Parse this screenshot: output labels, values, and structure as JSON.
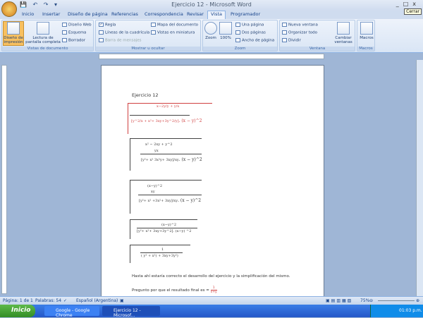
{
  "window": {
    "title": "Ejercicio 12 - Microsoft Word",
    "tooltip": "Cerrar",
    "controls": [
      "_",
      "□",
      "x"
    ]
  },
  "qat": [
    "save-icon",
    "undo-icon",
    "redo-icon",
    "customize-icon"
  ],
  "tabs": [
    "Inicio",
    "Insertar",
    "Diseño de página",
    "Referencias",
    "Correspondencia",
    "Revisar",
    "Vista",
    "Programador"
  ],
  "active_tab": "Vista",
  "ribbon": {
    "vistas": {
      "label": "Vistas de documento",
      "print": "Diseño de impresión",
      "reading": "Lectura de pantalla completa",
      "web": "Diseño Web",
      "outline": "Esquema",
      "draft": "Borrador"
    },
    "mostrar": {
      "label": "Mostrar u ocultar",
      "ruler": "Regla",
      "grid": "Líneas de la cuadrícula",
      "msgbar": "Barra de mensajes",
      "docmap": "Mapa del documento",
      "thumbs": "Vistas en miniatura",
      "ruler_checked": true
    },
    "zoom": {
      "label": "Zoom",
      "zoom": "Zoom",
      "pct": "100%",
      "one": "Una página",
      "two": "Dos páginas",
      "width": "Ancho de página"
    },
    "ventana": {
      "label": "Ventana",
      "new": "Nueva ventana",
      "arrange": "Organizar todo",
      "split": "Dividir",
      "switch": "Cambiar ventanas"
    },
    "macros": {
      "label": "Macros",
      "macros": "Macros"
    }
  },
  "document": {
    "heading": "Ejercicio 12",
    "eq1": {
      "num_a": "x−2y",
      "den_a": "y",
      "num_b": "y",
      "den_b": "x",
      "d1n": "y^2",
      "d1d": "x",
      "d2n": "x²+ 3xy+3y^2",
      "d2d": "y",
      "tail": ". (x − y)^2"
    },
    "eq2": {
      "num": "x² − 2xy + y^2",
      "numd": "yx",
      "dn": "y²+ x² 3x²y+ 3xy",
      "dd": "xy",
      "tail": ". (x − y)^2"
    },
    "eq3": {
      "num": "(x−y)^2",
      "numd": "xy",
      "dn": "y²+ x² +3x²+ 3xy",
      "dd": "xy",
      "tail": ". (x − y)^2"
    },
    "eq4": {
      "num": "(x−y)^2",
      "den": "[y²+ x²+ 3xy+3y^2]. (x−y) ^2"
    },
    "eq5": {
      "num": "1",
      "den": "( y² + x²) + 3xy+3y²)"
    },
    "para1": "Hasta ahí estaría correcto el desarrollo del ejercicio y la simplificación del mismo.",
    "para2": "Pregunto por que el resultado final es =",
    "result_num": "1",
    "result_den": "x+y"
  },
  "status": {
    "page": "Página: 1 de 1",
    "words": "Palabras: 54",
    "lang": "Español (Argentina)",
    "zoom": "75%"
  },
  "taskbar": {
    "start": "Inicio",
    "tasks": [
      "Google - Google Chrome",
      "Ejercicio 12 - Microsof..."
    ],
    "clock": "01:03 p.m."
  },
  "colors": {
    "error": "#d04040",
    "taskbar": "#2457c8",
    "active_view": "#f8c060"
  }
}
